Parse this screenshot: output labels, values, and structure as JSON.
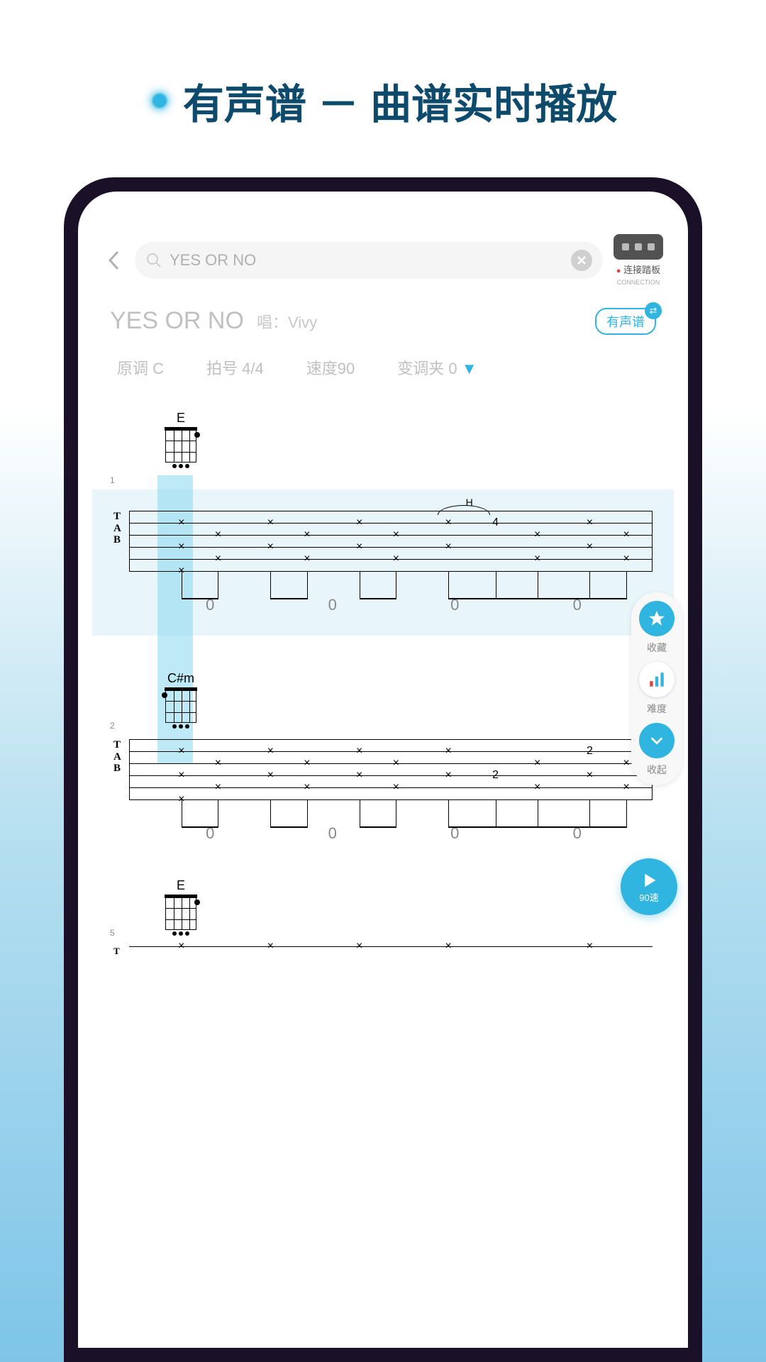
{
  "headline": "有声谱 － 曲谱实时播放",
  "search": {
    "value": "YES OR NO"
  },
  "pedal": {
    "label": "连接踏板",
    "sub": "CONNECTION"
  },
  "song": {
    "title": "YES OR NO",
    "singerPrefix": "唱：",
    "singer": "Vivy"
  },
  "audioBadge": "有声谱",
  "meta": {
    "key": "原调 C",
    "time": "拍号 4/4",
    "tempo": "速度90",
    "capo": "变调夹 0",
    "dropdown": "▼"
  },
  "chords": {
    "c1": "E",
    "c2": "C#m",
    "c3": "E"
  },
  "barNums": {
    "b1": "1",
    "b2": "2",
    "b3": "5"
  },
  "fretRow": {
    "v0": "0"
  },
  "special": {
    "h": "H",
    "four": "4",
    "two": "2"
  },
  "side": {
    "fav": "收藏",
    "diff": "难度",
    "collapse": "收起"
  },
  "play": {
    "label": "90速"
  }
}
